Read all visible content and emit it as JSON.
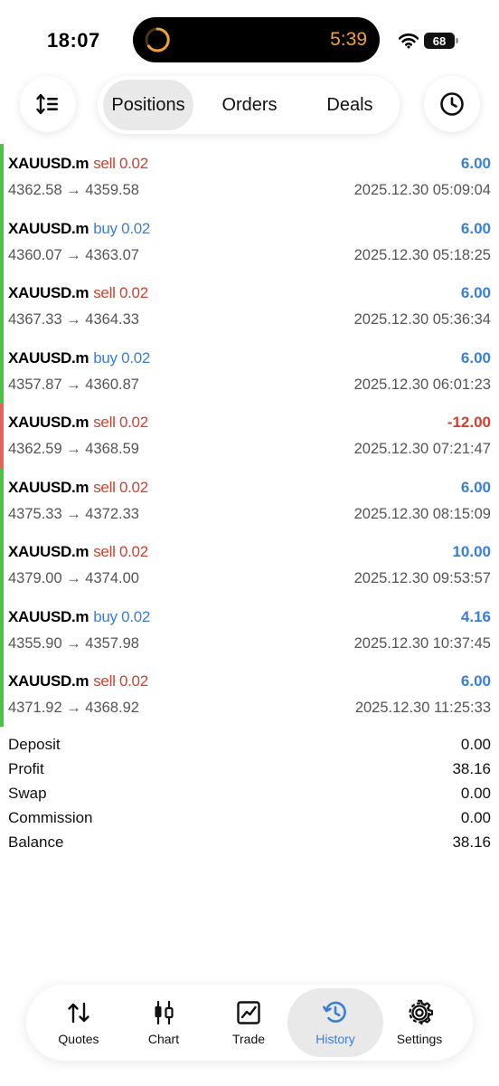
{
  "status_bar": {
    "time": "18:07",
    "timer": "5:39",
    "battery": "68"
  },
  "tabs": [
    {
      "label": "Positions",
      "selected": true
    },
    {
      "label": "Orders",
      "selected": false
    },
    {
      "label": "Deals",
      "selected": false
    }
  ],
  "positions": [
    {
      "symbol": "XAUUSD.m",
      "side": "sell 0.02",
      "type": "sell",
      "profit": "6.00",
      "profit_color": "#3b7fd4",
      "bar_color": "#4cc04a",
      "prices": "4362.58 → 4359.58",
      "time": "2025.12.30 05:09:04"
    },
    {
      "symbol": "XAUUSD.m",
      "side": "buy 0.02",
      "type": "buy",
      "profit": "6.00",
      "profit_color": "#3b7fd4",
      "bar_color": "#4cc04a",
      "prices": "4360.07 → 4363.07",
      "time": "2025.12.30 05:18:25"
    },
    {
      "symbol": "XAUUSD.m",
      "side": "sell 0.02",
      "type": "sell",
      "profit": "6.00",
      "profit_color": "#3b7fd4",
      "bar_color": "#4cc04a",
      "prices": "4367.33 → 4364.33",
      "time": "2025.12.30 05:36:34"
    },
    {
      "symbol": "XAUUSD.m",
      "side": "buy 0.02",
      "type": "buy",
      "profit": "6.00",
      "profit_color": "#3b7fd4",
      "bar_color": "#4cc04a",
      "prices": "4357.87 → 4360.87",
      "time": "2025.12.30 06:01:23"
    },
    {
      "symbol": "XAUUSD.m",
      "side": "sell 0.02",
      "type": "sell",
      "profit": "-12.00",
      "profit_color": "#d2402c",
      "bar_color": "#e2655c",
      "prices": "4362.59 → 4368.59",
      "time": "2025.12.30 07:21:47"
    },
    {
      "symbol": "XAUUSD.m",
      "side": "sell 0.02",
      "type": "sell",
      "profit": "6.00",
      "profit_color": "#3b7fd4",
      "bar_color": "#4cc04a",
      "prices": "4375.33 → 4372.33",
      "time": "2025.12.30 08:15:09"
    },
    {
      "symbol": "XAUUSD.m",
      "side": "sell 0.02",
      "type": "sell",
      "profit": "10.00",
      "profit_color": "#3b7fd4",
      "bar_color": "#4cc04a",
      "prices": "4379.00 → 4374.00",
      "time": "2025.12.30 09:53:57"
    },
    {
      "symbol": "XAUUSD.m",
      "side": "buy 0.02",
      "type": "buy",
      "profit": "4.16",
      "profit_color": "#3b7fd4",
      "bar_color": "#4cc04a",
      "prices": "4355.90 → 4357.98",
      "time": "2025.12.30 10:37:45"
    },
    {
      "symbol": "XAUUSD.m",
      "side": "sell 0.02",
      "type": "sell",
      "profit": "6.00",
      "profit_color": "#3b7fd4",
      "bar_color": "#4cc04a",
      "prices": "4371.92 → 4368.92",
      "time": "2025.12.30 11:25:33"
    }
  ],
  "summary": [
    {
      "label": "Deposit",
      "value": "0.00"
    },
    {
      "label": "Profit",
      "value": "38.16"
    },
    {
      "label": "Swap",
      "value": "0.00"
    },
    {
      "label": "Commission",
      "value": "0.00"
    },
    {
      "label": "Balance",
      "value": "38.16"
    }
  ],
  "nav": [
    {
      "label": "Quotes",
      "icon": "quotes-icon",
      "active": false
    },
    {
      "label": "Chart",
      "icon": "chart-icon",
      "active": false
    },
    {
      "label": "Trade",
      "icon": "trade-icon",
      "active": false
    },
    {
      "label": "History",
      "icon": "history-icon",
      "active": true
    },
    {
      "label": "Settings",
      "icon": "settings-icon",
      "active": false
    }
  ],
  "colors": {
    "accent": "#3b7fd4",
    "sell": "#c9432f",
    "loss": "#d2402c",
    "win_bar": "#4cc04a",
    "loss_bar": "#e2655c"
  }
}
